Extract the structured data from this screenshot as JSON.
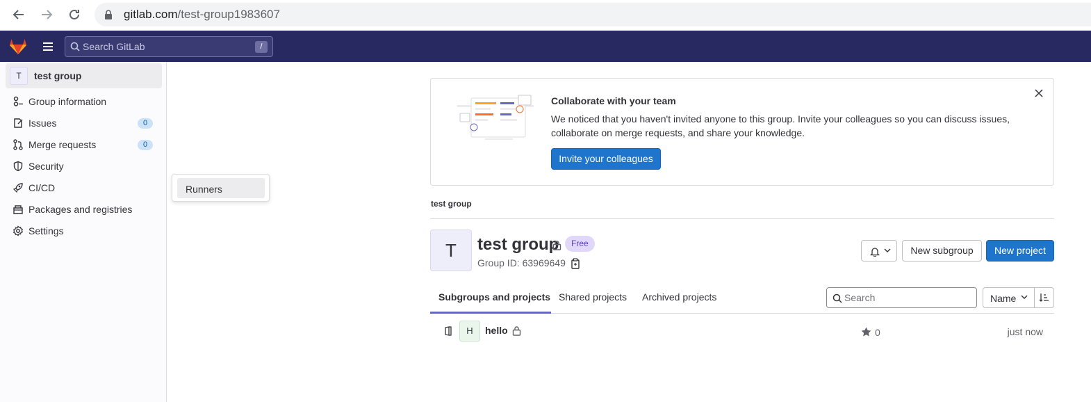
{
  "browser": {
    "url_host": "gitlab.com",
    "url_path": "/test-group1983607"
  },
  "topbar": {
    "search_placeholder": "Search GitLab",
    "search_shortcut": "/"
  },
  "sidebar": {
    "group_avatar": "T",
    "group_name": "test group",
    "items": [
      {
        "label": "Group information",
        "icon": "group-information-icon"
      },
      {
        "label": "Issues",
        "icon": "issues-icon",
        "count": "0"
      },
      {
        "label": "Merge requests",
        "icon": "merge-request-icon",
        "count": "0"
      },
      {
        "label": "Security",
        "icon": "shield-icon"
      },
      {
        "label": "CI/CD",
        "icon": "rocket-icon"
      },
      {
        "label": "Packages and registries",
        "icon": "package-icon"
      },
      {
        "label": "Settings",
        "icon": "gear-icon"
      }
    ]
  },
  "flyout": {
    "item": "Runners"
  },
  "banner": {
    "title": "Collaborate with your team",
    "body": "We noticed that you haven't invited anyone to this group. Invite your colleagues so you can discuss issues, collaborate on merge requests, and share your knowledge.",
    "button": "Invite your colleagues"
  },
  "breadcrumb": "test group",
  "group": {
    "avatar": "T",
    "name": "test group",
    "plan_badge": "Free",
    "id_text": "Group ID: 63969649"
  },
  "actions": {
    "new_subgroup": "New subgroup",
    "new_project": "New project"
  },
  "tabs": [
    "Subgroups and projects",
    "Shared projects",
    "Archived projects"
  ],
  "filter": {
    "search_placeholder": "Search",
    "sort_label": "Name"
  },
  "projects": [
    {
      "avatar": "H",
      "name": "hello",
      "stars": "0",
      "updated": "just now"
    }
  ],
  "colors": {
    "topbar": "#292961",
    "primary": "#1f75cb",
    "tab_active": "#6666c4",
    "badge_bg": "#e1d8f9"
  }
}
